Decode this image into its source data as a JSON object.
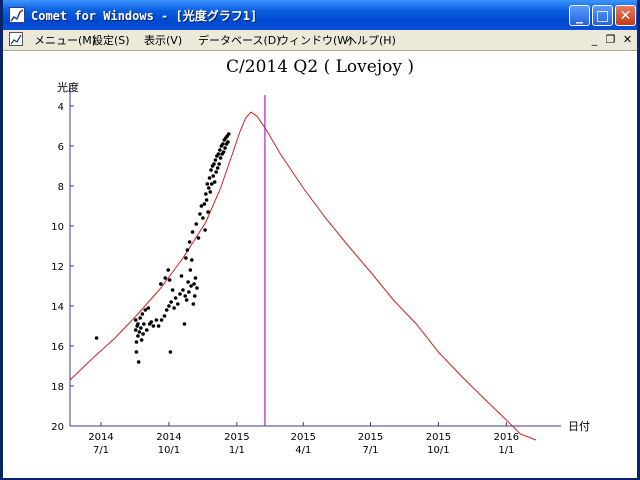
{
  "window": {
    "title": "Comet for Windows - [光度グラフ1]"
  },
  "titlebar_buttons": {
    "minimize": "_",
    "maximize": "□",
    "close": "✕"
  },
  "menu": [
    "メニュー(M)",
    "設定(S)",
    "表示(V)",
    "データベース(D)",
    "ウィンドウ(W)",
    "ヘルプ(H)"
  ],
  "mdi_buttons": {
    "minimize": "_",
    "restore": "❐",
    "close": "✕"
  },
  "chart_data": {
    "type": "scatter",
    "title": "C/2014 Q2 ( Lovejoy )",
    "ylabel": "光度",
    "xlabel": "日付",
    "y_inverted": true,
    "ylim": [
      20,
      3.5
    ],
    "xlim": [
      "2014-05-20",
      "2016-03-15"
    ],
    "yticks": [
      4,
      6,
      8,
      10,
      12,
      14,
      16,
      18,
      20
    ],
    "xticks": [
      {
        "date": "2014-07-01",
        "top": "2014",
        "bottom": "7/1"
      },
      {
        "date": "2014-10-01",
        "top": "2014",
        "bottom": "10/1"
      },
      {
        "date": "2015-01-01",
        "top": "2015",
        "bottom": "1/1"
      },
      {
        "date": "2015-04-01",
        "top": "2015",
        "bottom": "4/1"
      },
      {
        "date": "2015-07-01",
        "top": "2015",
        "bottom": "7/1"
      },
      {
        "date": "2015-10-01",
        "top": "2015",
        "bottom": "10/1"
      },
      {
        "date": "2016-01-01",
        "top": "2016",
        "bottom": "1/1"
      }
    ],
    "marker_date": "2015-02-08",
    "curve_color": "#cc2222",
    "marker_color": "#b020d0",
    "axis_color": "#3a3a8a",
    "curve": [
      {
        "x": "2014-05-20",
        "y": 17.7
      },
      {
        "x": "2014-06-20",
        "y": 16.6
      },
      {
        "x": "2014-07-20",
        "y": 15.6
      },
      {
        "x": "2014-08-20",
        "y": 14.4
      },
      {
        "x": "2014-09-20",
        "y": 13.1
      },
      {
        "x": "2014-10-20",
        "y": 11.6
      },
      {
        "x": "2014-11-20",
        "y": 9.8
      },
      {
        "x": "2014-12-10",
        "y": 8.1
      },
      {
        "x": "2014-12-25",
        "y": 6.5
      },
      {
        "x": "2015-01-05",
        "y": 5.3
      },
      {
        "x": "2015-01-13",
        "y": 4.6
      },
      {
        "x": "2015-01-20",
        "y": 4.3
      },
      {
        "x": "2015-01-28",
        "y": 4.5
      },
      {
        "x": "2015-02-10",
        "y": 5.2
      },
      {
        "x": "2015-03-01",
        "y": 6.4
      },
      {
        "x": "2015-04-01",
        "y": 8.1
      },
      {
        "x": "2015-05-01",
        "y": 9.6
      },
      {
        "x": "2015-06-01",
        "y": 11.0
      },
      {
        "x": "2015-07-01",
        "y": 12.3
      },
      {
        "x": "2015-08-01",
        "y": 13.7
      },
      {
        "x": "2015-09-01",
        "y": 14.9
      },
      {
        "x": "2015-10-01",
        "y": 16.3
      },
      {
        "x": "2015-11-01",
        "y": 17.5
      },
      {
        "x": "2015-12-01",
        "y": 18.6
      },
      {
        "x": "2016-01-01",
        "y": 19.7
      },
      {
        "x": "2016-01-20",
        "y": 20.4
      },
      {
        "x": "2016-02-10",
        "y": 20.7
      }
    ],
    "points": [
      {
        "x": "2014-06-25",
        "y": 15.6
      },
      {
        "x": "2014-08-17",
        "y": 14.7
      },
      {
        "x": "2014-08-17",
        "y": 15.2
      },
      {
        "x": "2014-08-18",
        "y": 15.8
      },
      {
        "x": "2014-08-18",
        "y": 16.3
      },
      {
        "x": "2014-08-19",
        "y": 15.0
      },
      {
        "x": "2014-08-20",
        "y": 14.9
      },
      {
        "x": "2014-08-20",
        "y": 15.5
      },
      {
        "x": "2014-08-21",
        "y": 16.8
      },
      {
        "x": "2014-08-22",
        "y": 15.3
      },
      {
        "x": "2014-08-23",
        "y": 14.6
      },
      {
        "x": "2014-08-24",
        "y": 15.1
      },
      {
        "x": "2014-08-25",
        "y": 15.7
      },
      {
        "x": "2014-08-26",
        "y": 14.4
      },
      {
        "x": "2014-08-27",
        "y": 15.4
      },
      {
        "x": "2014-08-28",
        "y": 14.9
      },
      {
        "x": "2014-08-30",
        "y": 14.2
      },
      {
        "x": "2014-09-01",
        "y": 15.2
      },
      {
        "x": "2014-09-03",
        "y": 14.1
      },
      {
        "x": "2014-09-05",
        "y": 14.9
      },
      {
        "x": "2014-09-07",
        "y": 14.8
      },
      {
        "x": "2014-09-10",
        "y": 15.0
      },
      {
        "x": "2014-09-14",
        "y": 14.7
      },
      {
        "x": "2014-09-17",
        "y": 15.0
      },
      {
        "x": "2014-09-20",
        "y": 12.9
      },
      {
        "x": "2014-09-21",
        "y": 14.7
      },
      {
        "x": "2014-09-25",
        "y": 14.5
      },
      {
        "x": "2014-09-26",
        "y": 12.6
      },
      {
        "x": "2014-09-28",
        "y": 14.2
      },
      {
        "x": "2014-09-30",
        "y": 12.2
      },
      {
        "x": "2014-10-01",
        "y": 14.0
      },
      {
        "x": "2014-10-02",
        "y": 12.7
      },
      {
        "x": "2014-10-03",
        "y": 16.3
      },
      {
        "x": "2014-10-04",
        "y": 13.8
      },
      {
        "x": "2014-10-06",
        "y": 13.2
      },
      {
        "x": "2014-10-08",
        "y": 14.1
      },
      {
        "x": "2014-10-10",
        "y": 13.6
      },
      {
        "x": "2014-10-13",
        "y": 13.9
      },
      {
        "x": "2014-10-16",
        "y": 13.4
      },
      {
        "x": "2014-10-18",
        "y": 12.5
      },
      {
        "x": "2014-10-20",
        "y": 13.2
      },
      {
        "x": "2014-10-22",
        "y": 14.9
      },
      {
        "x": "2014-10-23",
        "y": 13.5
      },
      {
        "x": "2014-10-24",
        "y": 11.6
      },
      {
        "x": "2014-10-25",
        "y": 13.7
      },
      {
        "x": "2014-10-26",
        "y": 11.2
      },
      {
        "x": "2014-10-27",
        "y": 12.8
      },
      {
        "x": "2014-10-28",
        "y": 13.3
      },
      {
        "x": "2014-10-29",
        "y": 10.8
      },
      {
        "x": "2014-10-30",
        "y": 12.2
      },
      {
        "x": "2014-10-31",
        "y": 13.0
      },
      {
        "x": "2014-11-01",
        "y": 11.7
      },
      {
        "x": "2014-11-02",
        "y": 10.3
      },
      {
        "x": "2014-11-03",
        "y": 13.9
      },
      {
        "x": "2014-11-04",
        "y": 12.9
      },
      {
        "x": "2014-11-05",
        "y": 13.5
      },
      {
        "x": "2014-11-06",
        "y": 12.6
      },
      {
        "x": "2014-11-07",
        "y": 9.9
      },
      {
        "x": "2014-11-08",
        "y": 13.1
      },
      {
        "x": "2014-11-10",
        "y": 10.6
      },
      {
        "x": "2014-11-12",
        "y": 9.4
      },
      {
        "x": "2014-11-14",
        "y": 9.0
      },
      {
        "x": "2014-11-16",
        "y": 9.6
      },
      {
        "x": "2014-11-18",
        "y": 8.9
      },
      {
        "x": "2014-11-19",
        "y": 10.2
      },
      {
        "x": "2014-11-20",
        "y": 8.4
      },
      {
        "x": "2014-11-21",
        "y": 8.7
      },
      {
        "x": "2014-11-22",
        "y": 7.9
      },
      {
        "x": "2014-11-23",
        "y": 9.3
      },
      {
        "x": "2014-11-24",
        "y": 8.1
      },
      {
        "x": "2014-11-25",
        "y": 7.6
      },
      {
        "x": "2014-11-26",
        "y": 8.3
      },
      {
        "x": "2014-11-27",
        "y": 7.2
      },
      {
        "x": "2014-11-28",
        "y": 7.9
      },
      {
        "x": "2014-11-29",
        "y": 7.0
      },
      {
        "x": "2014-11-30",
        "y": 7.5
      },
      {
        "x": "2014-12-01",
        "y": 6.9
      },
      {
        "x": "2014-12-02",
        "y": 7.8
      },
      {
        "x": "2014-12-03",
        "y": 6.7
      },
      {
        "x": "2014-12-04",
        "y": 7.3
      },
      {
        "x": "2014-12-05",
        "y": 6.5
      },
      {
        "x": "2014-12-06",
        "y": 7.1
      },
      {
        "x": "2014-12-07",
        "y": 6.4
      },
      {
        "x": "2014-12-08",
        "y": 6.9
      },
      {
        "x": "2014-12-09",
        "y": 6.2
      },
      {
        "x": "2014-12-10",
        "y": 6.6
      },
      {
        "x": "2014-12-11",
        "y": 6.0
      },
      {
        "x": "2014-12-12",
        "y": 6.4
      },
      {
        "x": "2014-12-13",
        "y": 5.9
      },
      {
        "x": "2014-12-14",
        "y": 6.3
      },
      {
        "x": "2014-12-15",
        "y": 5.7
      },
      {
        "x": "2014-12-16",
        "y": 6.1
      },
      {
        "x": "2014-12-17",
        "y": 5.6
      },
      {
        "x": "2014-12-18",
        "y": 5.9
      },
      {
        "x": "2014-12-19",
        "y": 5.5
      },
      {
        "x": "2014-12-20",
        "y": 5.8
      },
      {
        "x": "2014-12-21",
        "y": 5.4
      }
    ]
  }
}
